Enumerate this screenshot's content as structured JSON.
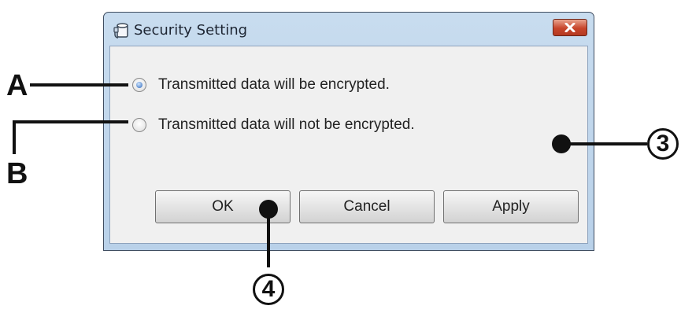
{
  "window": {
    "title": "Security Setting",
    "icon": "security-setting-app-icon",
    "close_icon": "close-icon"
  },
  "options": [
    {
      "label": "Transmitted data will be encrypted.",
      "selected": true
    },
    {
      "label": "Transmitted data will not be encrypted.",
      "selected": false
    }
  ],
  "buttons": {
    "ok": "OK",
    "cancel": "Cancel",
    "apply": "Apply"
  },
  "callouts": {
    "a": "A",
    "b": "B",
    "three": "3",
    "four": "4"
  },
  "colors": {
    "titlebar": "#c8dcef",
    "client_bg": "#f0f0f0",
    "close_button": "#c7452b",
    "radio_selected": "#2a63b8"
  }
}
